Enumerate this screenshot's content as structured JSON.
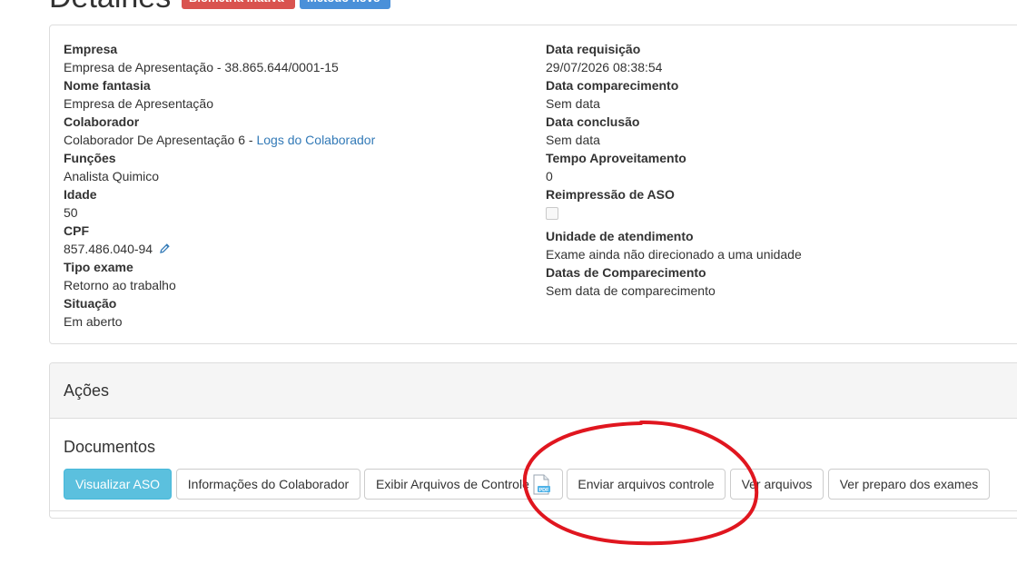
{
  "header": {
    "title": "Detalhes",
    "badges": [
      {
        "label": "Biometria inativa",
        "color": "#d9534f"
      },
      {
        "label": "Método novo",
        "color": "#4a90d9"
      }
    ]
  },
  "details": {
    "left": [
      {
        "label": "Empresa",
        "value": "Empresa de Apresentação - 38.865.644/0001-15"
      },
      {
        "label": "Nome fantasia",
        "value": "Empresa de Apresentação"
      },
      {
        "label": "Colaborador",
        "value": "Colaborador De Apresentação 6 - ",
        "link": "Logs do Colaborador"
      },
      {
        "label": "Funções",
        "value": "Analista Quimico"
      },
      {
        "label": "Idade",
        "value": "50"
      },
      {
        "label": "CPF",
        "value": "857.486.040-94"
      },
      {
        "label": "Tipo exame",
        "value": "Retorno ao trabalho"
      },
      {
        "label": "Situação",
        "value": "Em aberto"
      }
    ],
    "right": [
      {
        "label": "Data requisição",
        "value": "29/07/2026 08:38:54"
      },
      {
        "label": "Data comparecimento",
        "value": "Sem data"
      },
      {
        "label": "Data conclusão",
        "value": "Sem data"
      },
      {
        "label": "Tempo Aproveitamento",
        "value": "0"
      },
      {
        "label": "Reimpressão de ASO",
        "checked": false
      },
      {
        "label": "Unidade de atendimento",
        "value": "Exame ainda não direcionado a uma unidade"
      },
      {
        "label": "Datas de Comparecimento",
        "value": "Sem data de comparecimento"
      }
    ]
  },
  "actions": {
    "title": "Ações",
    "documents_title": "Documentos",
    "buttons": [
      "Visualizar ASO",
      "Informações do Colaborador",
      "Exibir Arquivos de Controle",
      "Enviar arquivos controle",
      "Ver arquivos",
      "Ver preparo dos exames"
    ],
    "pdf_icon_text": "PDF"
  },
  "icons": {
    "cpf_edit": "pencil-icon",
    "pdf": "pdf-file-icon"
  },
  "colors": {
    "primary_button": "#5bc0de",
    "link": "#337ab7",
    "annotation": "#e0161f"
  }
}
